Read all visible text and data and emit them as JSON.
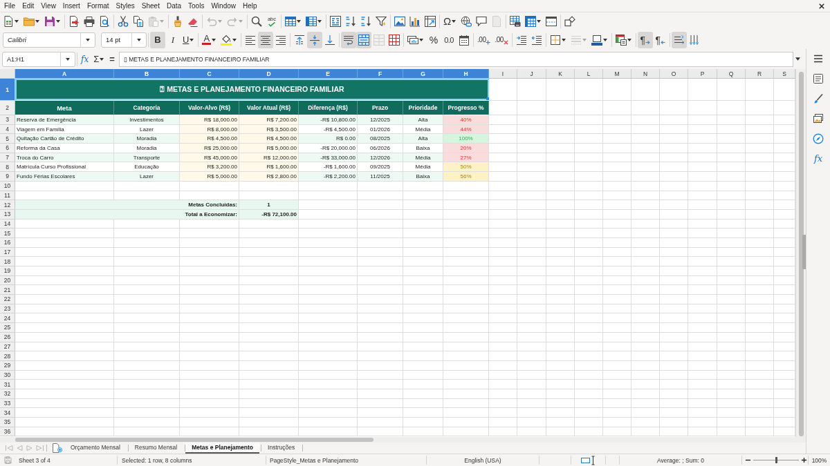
{
  "menu_bar": [
    "File",
    "Edit",
    "View",
    "Insert",
    "Format",
    "Styles",
    "Sheet",
    "Data",
    "Tools",
    "Window",
    "Help"
  ],
  "standard_toolbar": [
    {
      "disabled": false
    },
    {
      "disabled": false
    },
    {
      "disabled": false
    },
    {
      "disabled": false
    },
    {
      "disabled": false
    },
    {
      "disabled": false
    },
    {
      "disabled": false
    },
    {
      "disabled": false
    },
    {
      "disabled": true
    },
    {
      "disabled": false
    },
    {
      "disabled": false
    },
    {
      "disabled": true
    },
    {
      "disabled": true
    },
    {
      "disabled": false
    },
    {
      "label": "abc",
      "disabled": false
    },
    {
      "disabled": false
    },
    {
      "disabled": false
    },
    {
      "disabled": false
    },
    {
      "disabled": false
    },
    {
      "disabled": false
    },
    {
      "disabled": false
    },
    {
      "disabled": false
    },
    {
      "disabled": false
    },
    {
      "disabled": false
    },
    {
      "label": "Ω",
      "disabled": false
    },
    {
      "disabled": false
    },
    {
      "disabled": false
    },
    {
      "disabled": true
    },
    {
      "disabled": false
    },
    {
      "disabled": false
    },
    {
      "disabled": false
    },
    {
      "disabled": false
    }
  ],
  "formatting_toolbar": {
    "font_name": "Calibri",
    "font_size": "14 pt",
    "buttons": [
      {
        "label": "B",
        "active": true,
        "disabled": false
      },
      {
        "label": "I",
        "active": false,
        "disabled": false
      },
      {
        "label": "U",
        "active": false,
        "disabled": false
      },
      {
        "label": "A",
        "active": false,
        "disabled": false
      },
      {
        "active": false,
        "disabled": false
      },
      {
        "active": false,
        "disabled": false
      },
      {
        "active": true,
        "disabled": false
      },
      {
        "active": false,
        "disabled": false
      },
      {
        "active": false,
        "disabled": false
      },
      {
        "active": true,
        "disabled": false
      },
      {
        "active": false,
        "disabled": false
      },
      {
        "active": true,
        "disabled": false
      },
      {
        "active": true,
        "disabled": false
      },
      {
        "active": false,
        "disabled": true
      },
      {
        "active": false,
        "disabled": false
      },
      {
        "active": false,
        "disabled": false
      },
      {
        "label": "%",
        "active": false,
        "disabled": false
      },
      {
        "label": "0.0",
        "active": false,
        "disabled": false
      },
      {
        "active": false,
        "disabled": false
      },
      {
        "label": ".00",
        "active": false,
        "disabled": false
      },
      {
        "label": ".00",
        "active": false,
        "disabled": false
      },
      {
        "active": false,
        "disabled": false
      },
      {
        "active": false,
        "disabled": false
      },
      {
        "active": false,
        "disabled": false
      },
      {
        "active": false,
        "disabled": true
      },
      {
        "active": false,
        "disabled": false
      },
      {
        "active": false,
        "disabled": false
      },
      {
        "label": "¶",
        "active": true,
        "disabled": false
      },
      {
        "label": "¶",
        "active": false,
        "disabled": false
      },
      {
        "active": true,
        "disabled": false
      },
      {
        "active": false,
        "disabled": false
      }
    ]
  },
  "formula_bar": {
    "name_box": "A1:H1",
    "function_wizard": "fx",
    "sum": "Σ",
    "formula": "=",
    "content": "▯ METAS E PLANEJAMENTO FINANCEIRO FAMILIAR"
  },
  "sheet": {
    "columns": [
      {
        "label": "A",
        "selected": true
      },
      {
        "label": "B",
        "selected": true
      },
      {
        "label": "C",
        "selected": true
      },
      {
        "label": "D",
        "selected": true
      },
      {
        "label": "E",
        "selected": true
      },
      {
        "label": "F",
        "selected": true
      },
      {
        "label": "G",
        "selected": true
      },
      {
        "label": "H",
        "selected": true
      },
      {
        "label": "I",
        "selected": false
      },
      {
        "label": "J",
        "selected": false
      },
      {
        "label": "K",
        "selected": false
      },
      {
        "label": "L",
        "selected": false
      },
      {
        "label": "M",
        "selected": false
      },
      {
        "label": "N",
        "selected": false
      },
      {
        "label": "O",
        "selected": false
      },
      {
        "label": "P",
        "selected": false
      },
      {
        "label": "Q",
        "selected": false
      },
      {
        "label": "R",
        "selected": false
      },
      {
        "label": "S",
        "selected": false
      }
    ],
    "rows": [
      {
        "label": "1",
        "selected": true
      },
      {
        "label": "2",
        "selected": false
      },
      {
        "label": "3",
        "selected": false
      },
      {
        "label": "4",
        "selected": false
      },
      {
        "label": "5",
        "selected": false
      },
      {
        "label": "6",
        "selected": false
      },
      {
        "label": "7",
        "selected": false
      },
      {
        "label": "8",
        "selected": false
      },
      {
        "label": "9",
        "selected": false
      },
      {
        "label": "10",
        "selected": false
      },
      {
        "label": "11",
        "selected": false
      },
      {
        "label": "12",
        "selected": false
      },
      {
        "label": "13",
        "selected": false
      },
      {
        "label": "14",
        "selected": false
      },
      {
        "label": "15",
        "selected": false
      },
      {
        "label": "16",
        "selected": false
      },
      {
        "label": "17",
        "selected": false
      },
      {
        "label": "18",
        "selected": false
      },
      {
        "label": "19",
        "selected": false
      },
      {
        "label": "20",
        "selected": false
      },
      {
        "label": "21",
        "selected": false
      },
      {
        "label": "22",
        "selected": false
      },
      {
        "label": "23",
        "selected": false
      },
      {
        "label": "24",
        "selected": false
      },
      {
        "label": "25",
        "selected": false
      },
      {
        "label": "26",
        "selected": false
      },
      {
        "label": "27",
        "selected": false
      },
      {
        "label": "28",
        "selected": false
      },
      {
        "label": "29",
        "selected": false
      },
      {
        "label": "30",
        "selected": false
      },
      {
        "label": "31",
        "selected": false
      },
      {
        "label": "32",
        "selected": false
      },
      {
        "label": "33",
        "selected": false
      },
      {
        "label": "34",
        "selected": false
      },
      {
        "label": "35",
        "selected": false
      },
      {
        "label": "36",
        "selected": false
      }
    ],
    "title": {
      "text": "⍰ METAS E PLANEJAMENTO FINANCEIRO FAMILIAR",
      "selected": true
    },
    "table": {
      "columns": [
        "Meta",
        "Categoria",
        "Valor-Alvo (R$)",
        "Valor Atual (R$)",
        "Diferença (R$)",
        "Prazo",
        "Prioridade",
        "Progresso %"
      ],
      "rows": [
        {
          "cells": [
            "Reserva de Emergência",
            "Investimentos",
            "R$ 18,000.00",
            "R$ 7,200.00",
            "-R$ 10,800.00",
            "12/2025",
            "Alta",
            "40%"
          ],
          "kind": "low"
        },
        {
          "cells": [
            "Viagem em Família",
            "Lazer",
            "R$ 8,000.00",
            "R$ 3,500.00",
            "-R$ 4,500.00",
            "01/2026",
            "Média",
            "44%"
          ],
          "kind": "low"
        },
        {
          "cells": [
            "Quitação Cartão de Crédito",
            "Moradia",
            "R$ 4,500.00",
            "R$ 4,500.00",
            "R$ 0.00",
            "08/2025",
            "Alta",
            "100%"
          ],
          "kind": "done"
        },
        {
          "cells": [
            "Reforma da Casa",
            "Moradia",
            "R$ 25,000.00",
            "R$ 5,000.00",
            "-R$ 20,000.00",
            "06/2026",
            "Baixa",
            "20%"
          ],
          "kind": "low"
        },
        {
          "cells": [
            "Troca do Carro",
            "Transporte",
            "R$ 45,000.00",
            "R$ 12,000.00",
            "-R$ 33,000.00",
            "12/2026",
            "Média",
            "27%"
          ],
          "kind": "low"
        },
        {
          "cells": [
            "Matrícula Curso Profissional",
            "Educação",
            "R$ 3,200.00",
            "R$ 1,600.00",
            "-R$ 1,600.00",
            "09/2025",
            "Média",
            "50%"
          ],
          "kind": "mid"
        },
        {
          "cells": [
            "Fundo Férias Escolares",
            "Lazer",
            "R$ 5,000.00",
            "R$ 2,800.00",
            "-R$ 2,200.00",
            "11/2025",
            "Baixa",
            "56%"
          ],
          "kind": "mid"
        }
      ]
    },
    "summary": [
      {
        "label": "Metas Concluídas:",
        "value": "1"
      },
      {
        "label": "Total a Economizar:",
        "value": "-R$ 72,100.00"
      }
    ]
  },
  "sheet_tabs": {
    "navigation": [
      {
        "disabled": true
      },
      {
        "disabled": true
      },
      {
        "disabled": true
      },
      {
        "disabled": true
      }
    ],
    "tabs": [
      {
        "label": "Orçamento Mensal",
        "selected": false
      },
      {
        "label": "Resumo Mensal",
        "selected": false
      },
      {
        "label": "Metas e Planejamento",
        "selected": true
      },
      {
        "label": "Instruções",
        "selected": false
      }
    ]
  },
  "sidebar": {
    "functions_label": "fx"
  },
  "status_bar": {
    "sheet": "Sheet 3 of 4",
    "selection": "Selected: 1 row, 8 columns",
    "page_style": "PageStyle_Metas e Planejamento",
    "language": "English (USA)",
    "statistics": "Average: ; Sum: 0",
    "zoom": {
      "level": 0.5,
      "reading": "100%"
    }
  }
}
